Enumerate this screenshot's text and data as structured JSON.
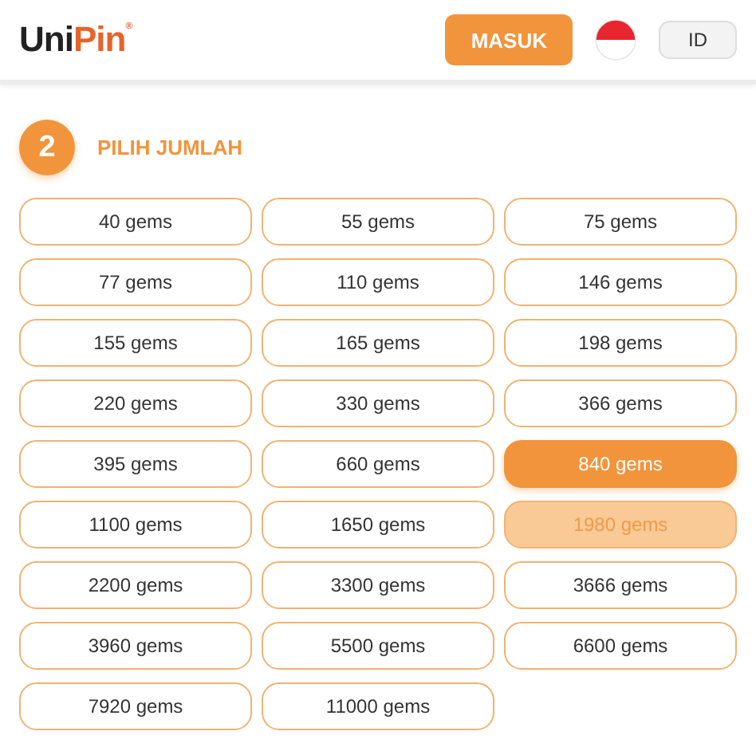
{
  "header": {
    "logo": {
      "first": "Uni",
      "second": "Pin",
      "mark": "®"
    },
    "login_button": "MASUK",
    "language": "ID"
  },
  "section": {
    "step": "2",
    "title": "PILIH JUMLAH"
  },
  "options": [
    {
      "label": "40 gems",
      "selected": false,
      "highlighted": false
    },
    {
      "label": "55 gems",
      "selected": false,
      "highlighted": false
    },
    {
      "label": "75 gems",
      "selected": false,
      "highlighted": false
    },
    {
      "label": "77 gems",
      "selected": false,
      "highlighted": false
    },
    {
      "label": "110 gems",
      "selected": false,
      "highlighted": false
    },
    {
      "label": "146 gems",
      "selected": false,
      "highlighted": false
    },
    {
      "label": "155 gems",
      "selected": false,
      "highlighted": false
    },
    {
      "label": "165 gems",
      "selected": false,
      "highlighted": false
    },
    {
      "label": "198 gems",
      "selected": false,
      "highlighted": false
    },
    {
      "label": "220 gems",
      "selected": false,
      "highlighted": false
    },
    {
      "label": "330 gems",
      "selected": false,
      "highlighted": false
    },
    {
      "label": "366 gems",
      "selected": false,
      "highlighted": false
    },
    {
      "label": "395 gems",
      "selected": false,
      "highlighted": false
    },
    {
      "label": "660 gems",
      "selected": false,
      "highlighted": false
    },
    {
      "label": "840 gems",
      "selected": true,
      "highlighted": false
    },
    {
      "label": "1100 gems",
      "selected": false,
      "highlighted": false
    },
    {
      "label": "1650 gems",
      "selected": false,
      "highlighted": false
    },
    {
      "label": "1980 gems",
      "selected": false,
      "highlighted": true
    },
    {
      "label": "2200 gems",
      "selected": false,
      "highlighted": false
    },
    {
      "label": "3300 gems",
      "selected": false,
      "highlighted": false
    },
    {
      "label": "3666 gems",
      "selected": false,
      "highlighted": false
    },
    {
      "label": "3960 gems",
      "selected": false,
      "highlighted": false
    },
    {
      "label": "5500 gems",
      "selected": false,
      "highlighted": false
    },
    {
      "label": "6600 gems",
      "selected": false,
      "highlighted": false
    },
    {
      "label": "7920 gems",
      "selected": false,
      "highlighted": false
    },
    {
      "label": "11000 gems",
      "selected": false,
      "highlighted": false
    }
  ]
}
